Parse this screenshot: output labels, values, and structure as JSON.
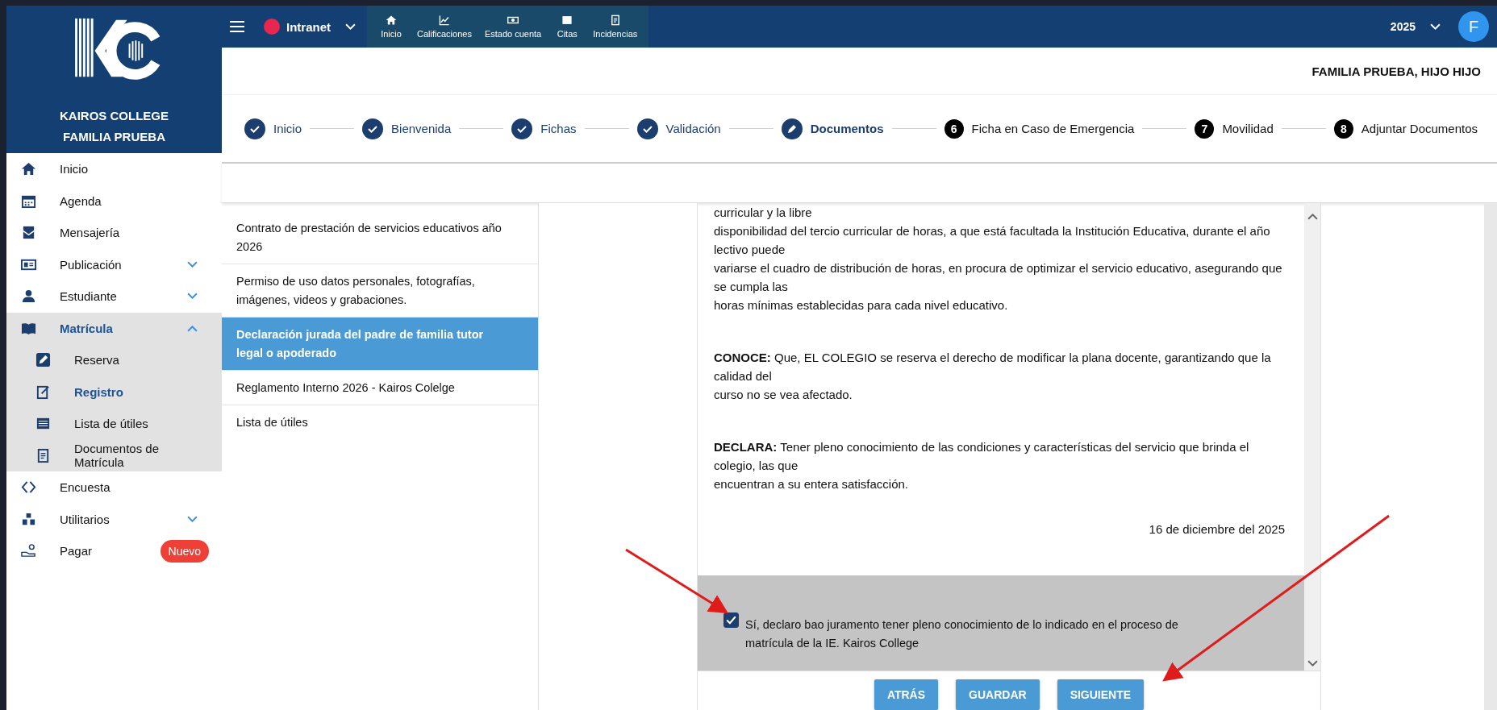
{
  "brand": {
    "name": "KAIROS COLLEGE",
    "family": "FAMILIA PRUEBA"
  },
  "topbar": {
    "app": "Intranet",
    "tabs": [
      {
        "label": "Inicio"
      },
      {
        "label": "Calificaciones"
      },
      {
        "label": "Estado cuenta"
      },
      {
        "label": "Citas"
      },
      {
        "label": "Incidencias"
      }
    ],
    "year": "2025",
    "avatar": "F"
  },
  "sidebar": {
    "items": [
      {
        "label": "Inicio",
        "selected": false
      },
      {
        "label": "Agenda",
        "selected": false
      },
      {
        "label": "Mensajería",
        "selected": false
      },
      {
        "label": "Publicación",
        "selected": false,
        "expanded": false
      },
      {
        "label": "Estudiante",
        "selected": false,
        "expanded": false
      },
      {
        "label": "Matrícula",
        "selected": true,
        "expanded": true,
        "children": [
          {
            "label": "Reserva",
            "selected": false
          },
          {
            "label": "Registro",
            "selected": true
          },
          {
            "label": "Lista de útiles",
            "selected": false
          },
          {
            "label": "Documentos de Matrícula",
            "selected": false
          }
        ]
      },
      {
        "label": "Encuesta",
        "selected": false
      },
      {
        "label": "Utilitarios",
        "selected": false,
        "expanded": false
      },
      {
        "label": "Pagar",
        "selected": false,
        "badge": "Nuevo"
      }
    ]
  },
  "student": "FAMILIA PRUEBA, HIJO HIJO",
  "steps": [
    {
      "label": "Inicio",
      "kind": "done"
    },
    {
      "label": "Bienvenida",
      "kind": "done"
    },
    {
      "label": "Fichas",
      "kind": "done"
    },
    {
      "label": "Validación",
      "kind": "done"
    },
    {
      "label": "Documentos",
      "kind": "current"
    },
    {
      "label": "Ficha en Caso de Emergencia",
      "kind": "pending",
      "number": "6"
    },
    {
      "label": "Movilidad",
      "kind": "pending",
      "number": "7"
    },
    {
      "label": "Adjuntar Documentos",
      "kind": "pending",
      "number": "8"
    }
  ],
  "documents": [
    {
      "label": "Contrato de prestación de servicios educativos año 2026",
      "selected": false
    },
    {
      "label": "Permiso de uso datos personales, fotografías, imágenes, videos y grabaciones.",
      "selected": false
    },
    {
      "label": "Declaración jurada del padre de familia tutor legal o apoderado",
      "selected": true
    },
    {
      "label": "Reglamento Interno 2026 - Kairos Colelge",
      "selected": false
    },
    {
      "label": "Lista de útiles",
      "selected": false
    }
  ],
  "viewer": {
    "paragraphs": [
      [
        "curricular y la libre",
        "disponibilidad del tercio curricular de horas, a que está facultada la Institución Educativa, durante el año",
        "lectivo puede",
        "variarse el cuadro de distribución de horas, en procura de optimizar el servicio educativo, asegurando que",
        "se cumpla las",
        "horas mínimas establecidas para cada nivel educativo."
      ],
      [
        "**CONOCE:** Que, EL COLEGIO se reserva el derecho de modificar la plana docente, garantizando que la",
        "calidad del",
        "curso no se vea afectado."
      ],
      [
        "**DECLARA:** Tener pleno conocimiento de las condiciones y características del servicio que brinda el",
        "colegio, las que",
        "encuentran a su entera satisfacción."
      ]
    ],
    "date": "16 de diciembre del 2025",
    "agreement": {
      "label": "Sí, declaro bao juramento tener pleno conocimiento de lo indicado en el proceso de matrícula de la IE. Kairos College",
      "checked": true
    }
  },
  "buttons": [
    "ATRÁS",
    "GUARDAR",
    "SIGUIENTE"
  ]
}
